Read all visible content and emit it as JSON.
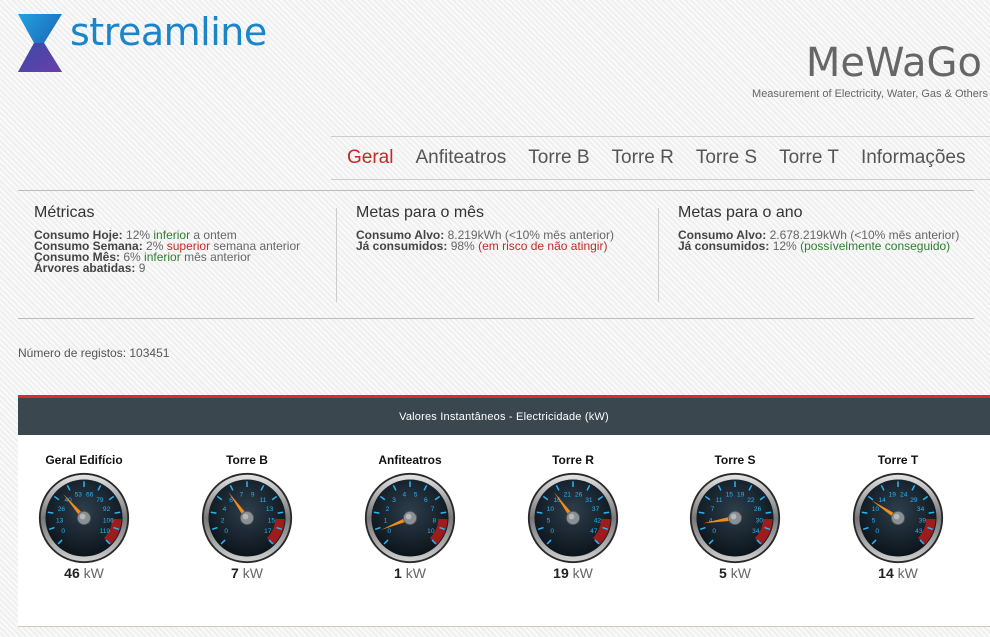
{
  "header": {
    "logo_text": "streamline",
    "app_title": "MeWaGo",
    "app_subtitle": "Measurement of Electricity, Water, Gas & Others"
  },
  "nav": {
    "items": [
      {
        "label": "Geral",
        "active": true
      },
      {
        "label": "Anfiteatros",
        "active": false
      },
      {
        "label": "Torre B",
        "active": false
      },
      {
        "label": "Torre R",
        "active": false
      },
      {
        "label": "Torre S",
        "active": false
      },
      {
        "label": "Torre T",
        "active": false
      },
      {
        "label": "Informações",
        "active": false
      }
    ]
  },
  "metrics": {
    "title": "Métricas",
    "today_label": "Consumo Hoje:",
    "today_pct": "12%",
    "today_dir": "inferior",
    "today_ref": "a ontem",
    "week_label": "Consumo Semana:",
    "week_pct": "2%",
    "week_dir": "superior",
    "week_ref": "semana anterior",
    "month_label": "Consumo Mês:",
    "month_pct": "6%",
    "month_dir": "inferior",
    "month_ref": "mês anterior",
    "trees_label": "Árvores abatidas:",
    "trees_value": "9"
  },
  "goals_month": {
    "title": "Metas para o mês",
    "target_label": "Consumo Alvo:",
    "target_value": "8.219kWh (<10% mês anterior)",
    "consumed_label": "Já consumidos:",
    "consumed_value": "98%",
    "consumed_status": "(em risco de não atingir)"
  },
  "goals_year": {
    "title": "Metas para o ano",
    "target_label": "Consumo Alvo:",
    "target_value": "2.678.219kWh (<10% mês anterior)",
    "consumed_label": "Já consumidos:",
    "consumed_value": "12%",
    "consumed_status": "(possívelmente conseguido)"
  },
  "records": {
    "text": "Número de registos: 103451"
  },
  "panel": {
    "title": "Valores Instantâneos - Electricidade (kW)",
    "unit": "kW",
    "gauges": [
      {
        "name": "Geral Edifício",
        "value": 46,
        "max": 132,
        "ticks": [
          0,
          13,
          26,
          40,
          53,
          66,
          79,
          92,
          106,
          119
        ]
      },
      {
        "name": "Torre B",
        "value": 7,
        "max": 19,
        "ticks": [
          0,
          2,
          4,
          6,
          7,
          9,
          11,
          13,
          15,
          17
        ]
      },
      {
        "name": "Anfiteatros",
        "value": 1,
        "max": 12,
        "ticks": [
          0,
          1,
          2,
          3,
          4,
          5,
          6,
          7,
          8,
          10
        ]
      },
      {
        "name": "Torre R",
        "value": 19,
        "max": 52,
        "ticks": [
          0,
          5,
          10,
          16,
          21,
          26,
          31,
          37,
          42,
          47
        ]
      },
      {
        "name": "Torre S",
        "value": 5,
        "max": 38,
        "ticks": [
          0,
          4,
          7,
          11,
          15,
          19,
          22,
          26,
          30,
          34
        ]
      },
      {
        "name": "Torre T",
        "value": 14,
        "max": 48,
        "ticks": [
          0,
          5,
          10,
          14,
          19,
          24,
          29,
          34,
          39,
          43
        ]
      }
    ]
  },
  "colors": {
    "accent_red": "#c62828",
    "good_green": "#2e7d32",
    "panel_header": "#3b474f",
    "logo_blue": "#1a86c9",
    "needle_orange": "#f28c1a",
    "tick_cyan": "#29b6f6"
  }
}
